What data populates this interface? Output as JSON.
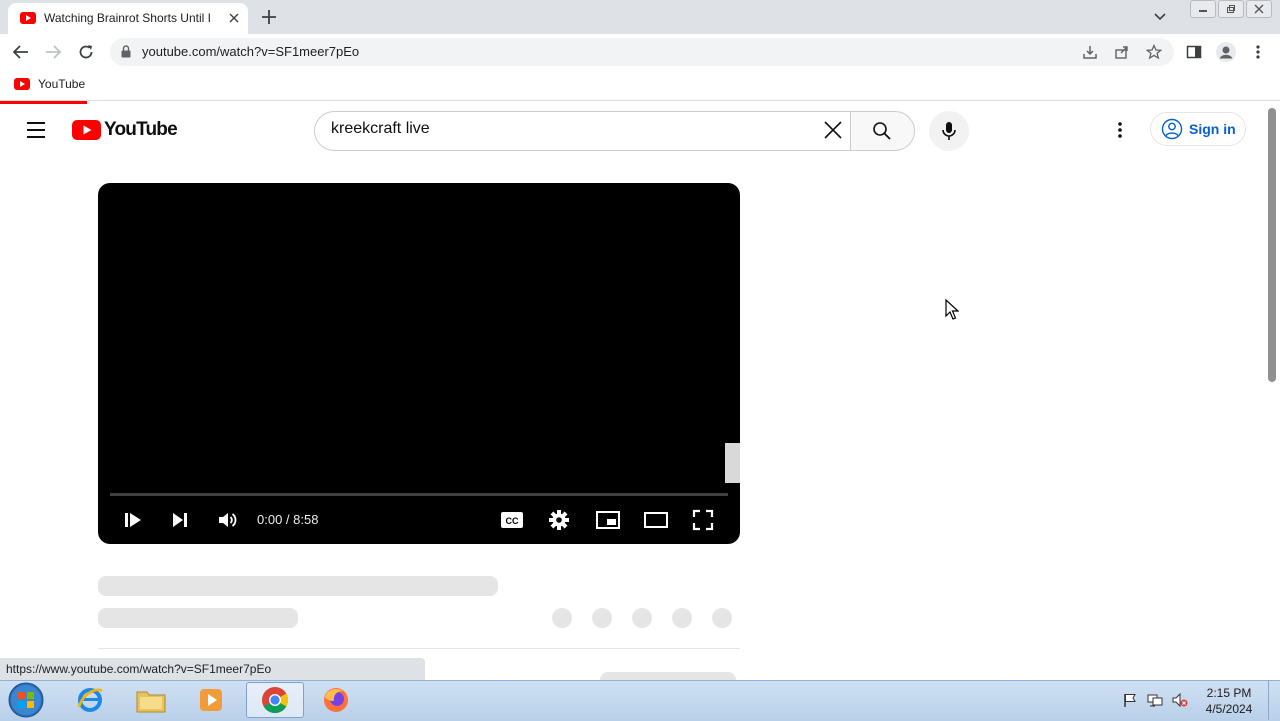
{
  "browser": {
    "tab_title": "Watching Brainrot Shorts Until I",
    "url": "youtube.com/watch?v=SF1meer7pEo",
    "bookmark": "YouTube",
    "status_url": "https://www.youtube.com/watch?v=SF1meer7pEo"
  },
  "youtube": {
    "logo_text": "YouTube",
    "search_value": "kreekcraft live",
    "signin_label": "Sign in",
    "accent": "#ff0000",
    "link_color": "#065fd4"
  },
  "player": {
    "time": "0:00 / 8:58",
    "progress": 0
  },
  "taskbar": {
    "time": "2:15 PM",
    "date": "4/5/2024"
  }
}
